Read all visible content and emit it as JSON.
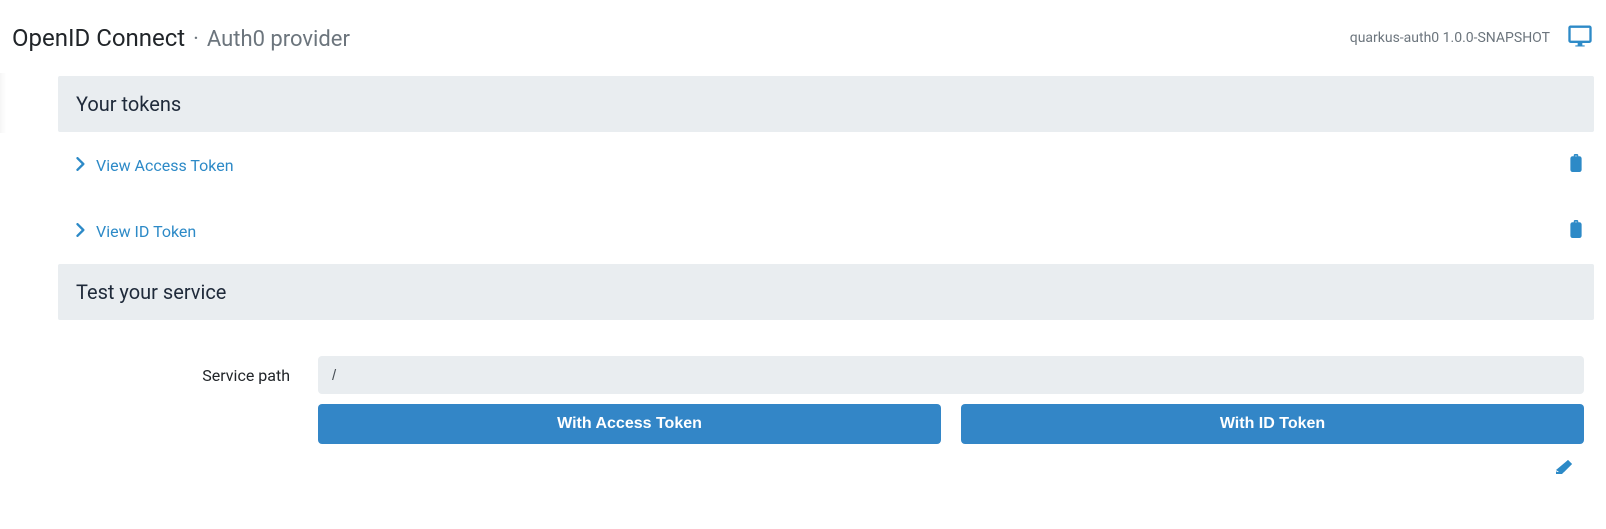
{
  "header": {
    "title": "OpenID Connect",
    "separator": "·",
    "subtitle": "Auth0 provider",
    "app_meta": "quarkus-auth0 1.0.0-SNAPSHOT"
  },
  "tokens_section": {
    "heading": "Your tokens",
    "items": [
      {
        "label": "View Access Token"
      },
      {
        "label": "View ID Token"
      }
    ]
  },
  "test_section": {
    "heading": "Test your service",
    "service_path_label": "Service path",
    "service_path_value": "/",
    "buttons": {
      "with_access": "With Access Token",
      "with_id": "With ID Token"
    }
  }
}
